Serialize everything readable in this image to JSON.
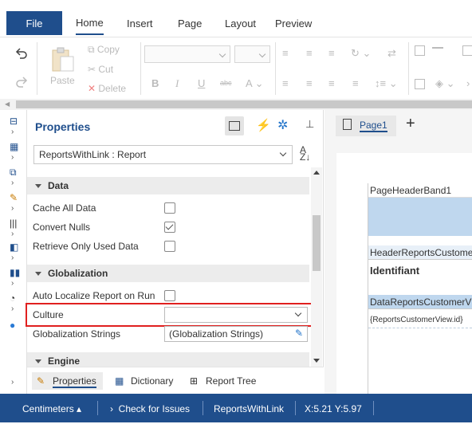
{
  "ribbon": {
    "tabs": [
      "Home",
      "Insert",
      "Page",
      "Layout",
      "Preview"
    ],
    "file_label": "File",
    "clipboard": {
      "paste": "Paste",
      "copy": "Copy",
      "cut": "Cut",
      "delete": "Delete"
    }
  },
  "properties": {
    "title": "Properties",
    "object_selector": "ReportsWithLink : Report",
    "categories": {
      "data": "Data",
      "globalization": "Globalization",
      "engine": "Engine"
    },
    "data_rows": [
      {
        "label": "Cache All Data",
        "checked": false
      },
      {
        "label": "Convert Nulls",
        "checked": true
      },
      {
        "label": "Retrieve Only Used Data",
        "checked": false
      }
    ],
    "glob_rows": {
      "auto_localize": {
        "label": "Auto Localize Report on Run",
        "checked": false
      },
      "culture": {
        "label": "Culture",
        "value": ""
      },
      "glob_strings": {
        "label": "Globalization Strings",
        "value": "(Globalization Strings)"
      }
    },
    "bottom_tabs": [
      "Properties",
      "Dictionary",
      "Report Tree"
    ],
    "highlight_color": "#e0201f"
  },
  "designer": {
    "page_tab": "Page1",
    "bands": {
      "page_header": "PageHeaderBand1",
      "header": "HeaderReportsCustome",
      "header_text": "Identifiant",
      "data": "DataReportsCustomerV",
      "data_text": "{ReportsCustomerView.id}"
    }
  },
  "status": {
    "units": "Centimeters",
    "check": "Check for Issues",
    "report": "ReportsWithLink",
    "coords": "X:5.21 Y:5.97"
  },
  "colors": {
    "accent": "#1f4e8c",
    "band_fill": "#bfd7ee"
  }
}
